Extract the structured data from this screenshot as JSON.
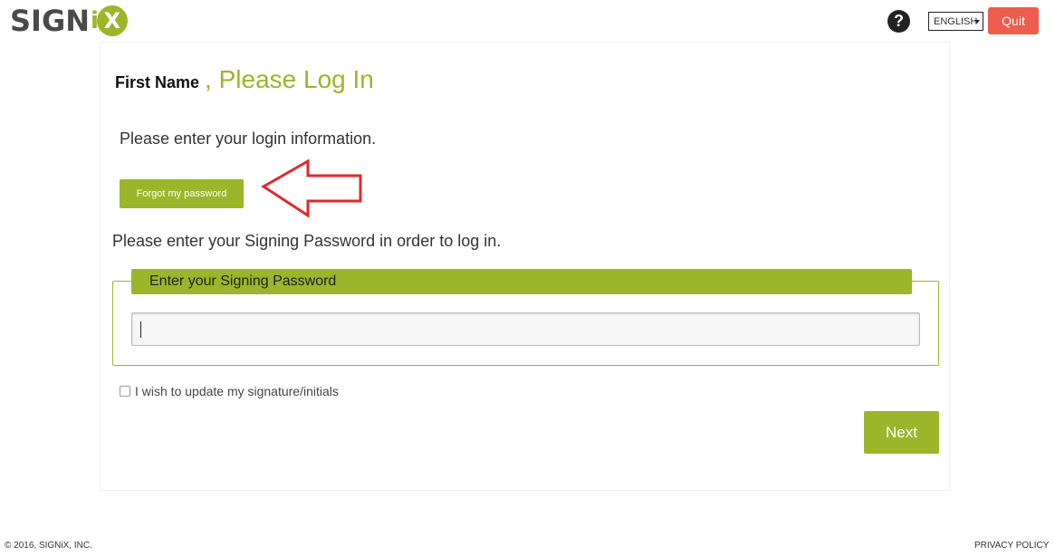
{
  "header": {
    "logo_text": "SIGN",
    "logo_i": "i",
    "logo_x": "X",
    "help_icon": "?",
    "language": "ENGLISH",
    "quit_label": "Quit"
  },
  "main": {
    "first_name": "First Name",
    "title": ", Please Log In",
    "intro": "Please enter your login information.",
    "forgot_label": "Forgot my password",
    "signing_prompt": "Please enter your Signing Password in order to log in.",
    "password_legend": "Enter your Signing Password",
    "password_value": "",
    "checkbox_label": "I wish to update my signature/initials",
    "checkbox_checked": false,
    "next_label": "Next"
  },
  "footer": {
    "copyright": "© 2016, SIGNiX, INC.",
    "privacy": "PRIVACY POLICY"
  },
  "colors": {
    "accent": "#9db52a",
    "quit": "#ee5c4c",
    "arrow": "#e0282e"
  }
}
